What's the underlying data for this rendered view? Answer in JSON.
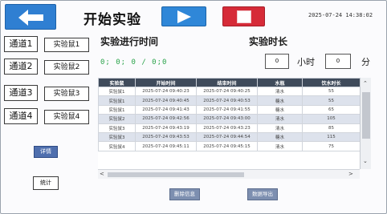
{
  "header": {
    "title": "开始实验",
    "datetime": "2025-07-24 14:38:02"
  },
  "left": {
    "channels": [
      {
        "channel": "通道1",
        "rat": "实验鼠1"
      },
      {
        "channel": "通道2",
        "rat": "实验鼠2"
      },
      {
        "channel": "通道3",
        "rat": "实验鼠3"
      },
      {
        "channel": "通道4",
        "rat": "实验鼠4"
      }
    ],
    "detail_label": "详情",
    "stats_label": "统计"
  },
  "experiment": {
    "run_time_label": "实验进行时间",
    "run_time_value": "0; 0; 0  /   0;0",
    "duration_label": "实验时长",
    "hours_value": "0",
    "hours_unit": "小时",
    "minutes_value": "0",
    "minutes_unit": "分"
  },
  "table": {
    "headers": [
      "实验鼠",
      "开始时间",
      "结束时间",
      "水瓶",
      "饮水时长"
    ],
    "rows": [
      [
        "实验鼠1",
        "2025-07-24 09:40:23",
        "2025-07-24 09:40:25",
        "清水",
        "55"
      ],
      [
        "实验鼠1",
        "2025-07-24 09:40:45",
        "2025-07-24 09:40:53",
        "糖水",
        "55"
      ],
      [
        "实验鼠1",
        "2025-07-24 09:41:43",
        "2025-07-24 09:41:55",
        "糖水",
        "65"
      ],
      [
        "实验鼠2",
        "2025-07-24 09:42:56",
        "2025-07-24 09:43:00",
        "清水",
        "105"
      ],
      [
        "实验鼠3",
        "2025-07-24 09:43:19",
        "2025-07-24 09:43:23",
        "清水",
        "85"
      ],
      [
        "实验鼠3",
        "2025-07-24 09:43:53",
        "2025-07-24 09:44:54",
        "糖水",
        "115"
      ],
      [
        "实验鼠4",
        "2025-07-24 09:45:11",
        "2025-07-24 09:45:15",
        "清水",
        "75"
      ]
    ]
  },
  "actions": {
    "clear_label": "删除信息",
    "export_label": "数据导出"
  },
  "colors": {
    "back": "#2f7fd2",
    "play": "#2f87d8",
    "stop": "#d62b38",
    "table_header": "#3f4b5b",
    "running_time": "#2aa34a"
  }
}
